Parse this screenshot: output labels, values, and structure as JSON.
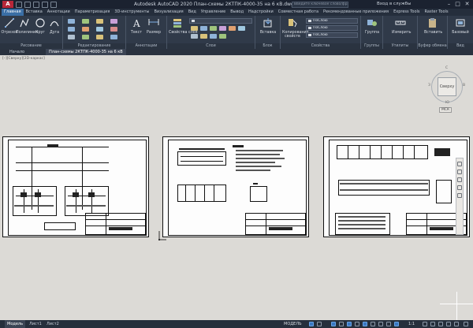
{
  "titlebar": {
    "logo": "A",
    "title": "Autodesk AutoCAD 2020   План-схемы 2КТПК-4000-35 на 6 кВ.dwg",
    "search_placeholder": "Введите ключевое слово/фразу",
    "signin": "Вход в службы",
    "minimize": "–",
    "maximize": "□",
    "close": "✕"
  },
  "ribbon_tabs": [
    "Главная",
    "Вставка",
    "Аннотации",
    "Параметризация",
    "3D-инструменты",
    "Визуализация",
    "Вид",
    "Управление",
    "Вывод",
    "Надстройки",
    "Совместная работа",
    "Рекомендованные приложения",
    "Express Tools",
    "Raster Tools"
  ],
  "ribbon": {
    "draw": {
      "title": "Рисование",
      "tools": [
        "Отрезок",
        "Полилиния",
        "Круг",
        "Дуга"
      ]
    },
    "modify": {
      "title": "Редактирование"
    },
    "annotation": {
      "title": "Аннотации",
      "tools": [
        "Текст",
        "Размер"
      ]
    },
    "layers": {
      "title": "Слои",
      "tools": [
        "Свойства слоя"
      ]
    },
    "block": {
      "title": "Блок",
      "tools": [
        "Вставка"
      ]
    },
    "properties": {
      "title": "Свойства",
      "tools": [
        "Копирование свойств"
      ],
      "combo1": "ПоСлою",
      "combo2": "ПоСлою",
      "combo3": "ПоСлою"
    },
    "groups": {
      "title": "Группы",
      "tools": [
        "Группа"
      ]
    },
    "utilities": {
      "title": "Утилиты",
      "tools": [
        "Измерить"
      ]
    },
    "clipboard": {
      "title": "Буфер обмена",
      "tools": [
        "Вставить"
      ]
    },
    "view": {
      "title": "Вид",
      "tools": [
        "Базовый"
      ]
    }
  },
  "doc_tabs": [
    "Начало",
    "План-схемы 2КТПК-4000-35 на 6 кВ"
  ],
  "canvas": {
    "viewport_label": "[–][Сверху][2D-каркас]",
    "viewcube": {
      "face": "Сверху",
      "n": "С",
      "s": "Ю",
      "w": "З",
      "e": "В",
      "ucs": "МСК"
    }
  },
  "layout_tabs": [
    "Модель",
    "Лист1",
    "Лист2"
  ],
  "statusbar": {
    "model": "МОДЕЛЬ",
    "scale": "1:1"
  },
  "colors": {
    "accent": "#3a6ea5",
    "canvas": "#dcdad6",
    "chrome": "#303a49"
  }
}
